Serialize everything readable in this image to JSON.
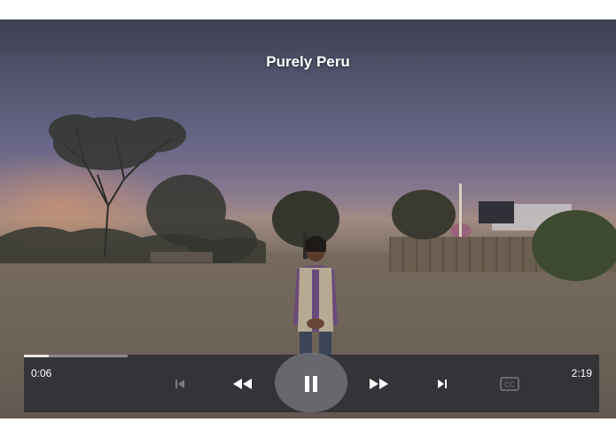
{
  "video": {
    "title": "Purely Peru"
  },
  "player": {
    "current_time": "0:06",
    "total_time": "2:19",
    "progress_fraction": 0.043,
    "controls": {
      "previous": "skip-previous-icon",
      "rewind": "rewind-icon",
      "play_pause": "pause-icon",
      "fast_forward": "fast-forward-icon",
      "next": "skip-next-icon",
      "captions": "closed-captions-icon"
    }
  },
  "colors": {
    "controls_bg": "#2d2e34",
    "text": "#ffffff",
    "disabled_icon": "#7a7b80"
  }
}
